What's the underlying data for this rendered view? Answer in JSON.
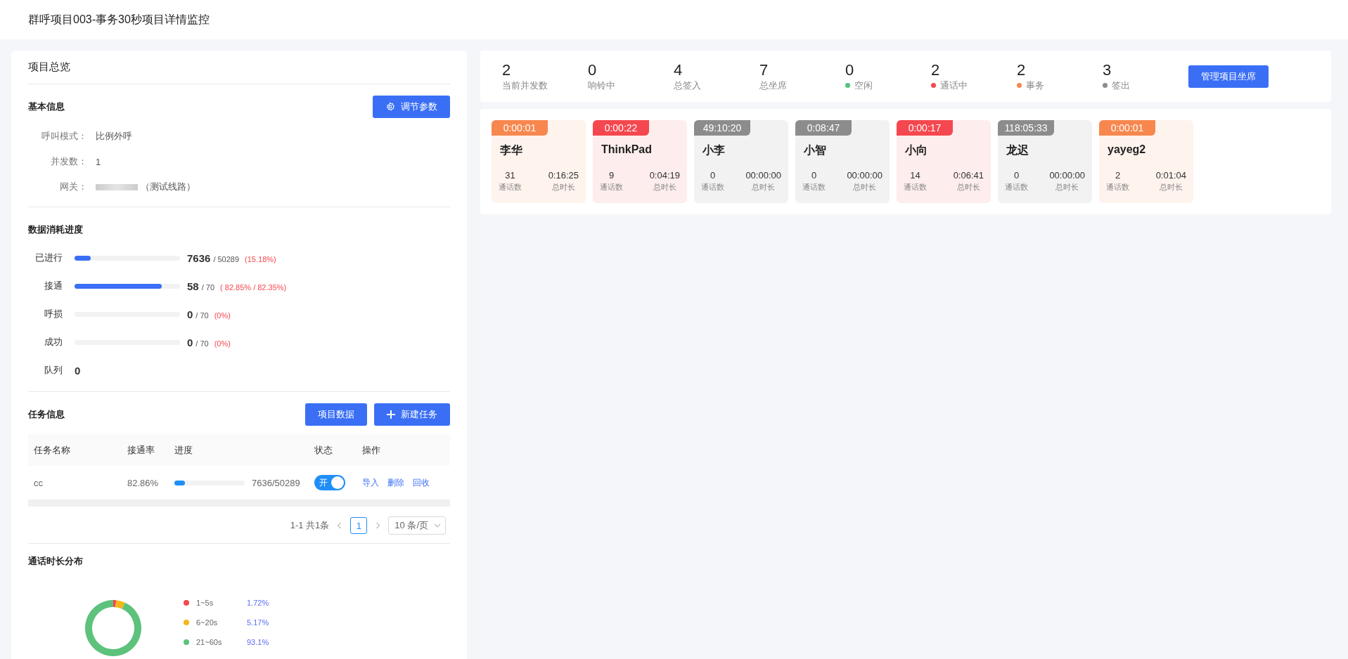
{
  "header": {
    "title": "群呼项目003-事务30秒项目详情监控"
  },
  "overview": {
    "title": "项目总览",
    "basic": {
      "title": "基本信息",
      "button": "调节参数",
      "fields": [
        {
          "label": "呼叫模式：",
          "value": "比例外呼"
        },
        {
          "label": "并发数：",
          "value": "1"
        },
        {
          "label": "网关：",
          "value": "（测试线路）",
          "redacted": true
        }
      ]
    },
    "consumption": {
      "title": "数据消耗进度",
      "rows": [
        {
          "kind": "bar",
          "label": "已进行",
          "value": "7636",
          "total": "/ 50289",
          "percent": "(15.18%)",
          "level": 0.152
        },
        {
          "kind": "bar",
          "label": "接通",
          "value": "58",
          "total": "/ 70",
          "percent": "( 82.85% / 82.35%)",
          "level": 0.829
        },
        {
          "kind": "bar",
          "label": "呼损",
          "value": "0",
          "total": "/ 70",
          "percent": "(0%)",
          "level": 0
        },
        {
          "kind": "bar",
          "label": "成功",
          "value": "0",
          "total": "/ 70",
          "percent": "(0%)",
          "level": 0
        },
        {
          "kind": "count",
          "label": "队列",
          "value": "0"
        }
      ]
    },
    "tasks": {
      "title": "任务信息",
      "buttons": [
        {
          "label": "项目数据",
          "kind": "plain"
        },
        {
          "label": "新建任务",
          "kind": "add"
        }
      ],
      "columns": [
        "任务名称",
        "接通率",
        "进度",
        "状态",
        "操作"
      ],
      "rows": [
        {
          "name": "cc",
          "rate": "82.86%",
          "progress": "7636/50289",
          "level": 0.152,
          "switch_label": "开",
          "on": true,
          "actions": [
            "导入",
            "删除",
            "回收"
          ]
        }
      ],
      "pagination": {
        "summary": "1-1 共1条",
        "pages": [
          {
            "label": "1",
            "selected": true
          }
        ],
        "page_size": "10 条/页"
      }
    },
    "duration": {
      "title": "通话时长分布",
      "legend": [
        {
          "value": "1.72%",
          "color": "#f5474f"
        },
        {
          "value": "5.17%",
          "color": "#f5b51c"
        },
        {
          "value": "93.1%",
          "color": "#5cc27c"
        }
      ],
      "chart_data": {
        "type": "donut",
        "categories": [
          "1~5s",
          "6~20s",
          "21~60s"
        ],
        "values": [
          1.72,
          5.17,
          93.1
        ]
      }
    }
  },
  "stats": {
    "items": [
      {
        "value": "2",
        "label": "当前并发数"
      },
      {
        "value": "0",
        "label": "响铃中"
      },
      {
        "value": "4",
        "label": "总签入"
      },
      {
        "value": "7",
        "label": "总坐席"
      },
      {
        "value": "0",
        "label": "空闲",
        "color": "#52c47a"
      },
      {
        "value": "2",
        "label": "通话中",
        "color": "#f5474f"
      },
      {
        "value": "2",
        "label": "事务",
        "color": "#f7874e"
      },
      {
        "value": "3",
        "label": "签出",
        "color": "#8c8c8c"
      }
    ],
    "button": "管理项目坐席"
  },
  "agents": [
    {
      "timer": "0:00:01",
      "color": "#f7874e",
      "name": "李华",
      "calls": "31",
      "calls_label": "通话数",
      "duration": "0:16:25",
      "duration_label": "总时长"
    },
    {
      "timer": "0:00:22",
      "color": "#f5474f",
      "name": "ThinkPad",
      "calls": "9",
      "calls_label": "通话数",
      "duration": "0:04:19",
      "duration_label": "总时长"
    },
    {
      "timer": "49:10:20",
      "color": "#8c8c8c",
      "name": "小李",
      "calls": "0",
      "calls_label": "通话数",
      "duration": "00:00:00",
      "duration_label": "总时长"
    },
    {
      "timer": "0:08:47",
      "color": "#8c8c8c",
      "name": "小智",
      "calls": "0",
      "calls_label": "通话数",
      "duration": "00:00:00",
      "duration_label": "总时长"
    },
    {
      "timer": "0:00:17",
      "color": "#f5474f",
      "name": "小向",
      "calls": "14",
      "calls_label": "通话数",
      "duration": "0:06:41",
      "duration_label": "总时长"
    },
    {
      "timer": "118:05:33",
      "color": "#8c8c8c",
      "name": "龙迟",
      "calls": "0",
      "calls_label": "通话数",
      "duration": "00:00:00",
      "duration_label": "总时长"
    },
    {
      "timer": "0:00:01",
      "color": "#f7874e",
      "name": "yayeg2",
      "calls": "2",
      "calls_label": "通话数",
      "duration": "0:01:04",
      "duration_label": "总时长"
    }
  ]
}
